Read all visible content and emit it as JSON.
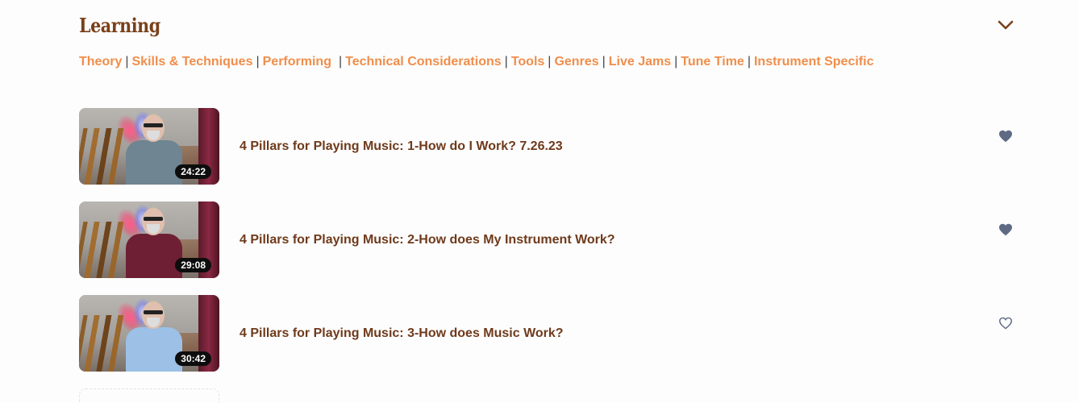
{
  "section": {
    "title": "Learning",
    "toggle_icon": "chevron-down-icon"
  },
  "categories": [
    {
      "label": "Theory"
    },
    {
      "label": "Skills & Techniques"
    },
    {
      "label": "Performing"
    },
    {
      "label": "Technical Considerations"
    },
    {
      "label": "Tools"
    },
    {
      "label": "Genres"
    },
    {
      "label": "Live Jams"
    },
    {
      "label": "Tune Time"
    },
    {
      "label": "Instrument Specific"
    }
  ],
  "separator": "|",
  "videos": [
    {
      "title": "4 Pillars for Playing Music: 1-How do I Work? 7.26.23",
      "duration": "24:22",
      "favorited": true,
      "shirt_color": "#6f8591"
    },
    {
      "title": "4 Pillars for Playing Music: 2-How does My Instrument Work?",
      "duration": "29:08",
      "favorited": true,
      "shirt_color": "#6e1f33"
    },
    {
      "title": "4 Pillars for Playing Music: 3-How does Music Work?",
      "duration": "30:42",
      "favorited": false,
      "shirt_color": "#9cc0e6"
    }
  ],
  "colors": {
    "title_brown": "#7a4019",
    "link_orange": "#f08e4b",
    "heart": "#5f6b85"
  }
}
